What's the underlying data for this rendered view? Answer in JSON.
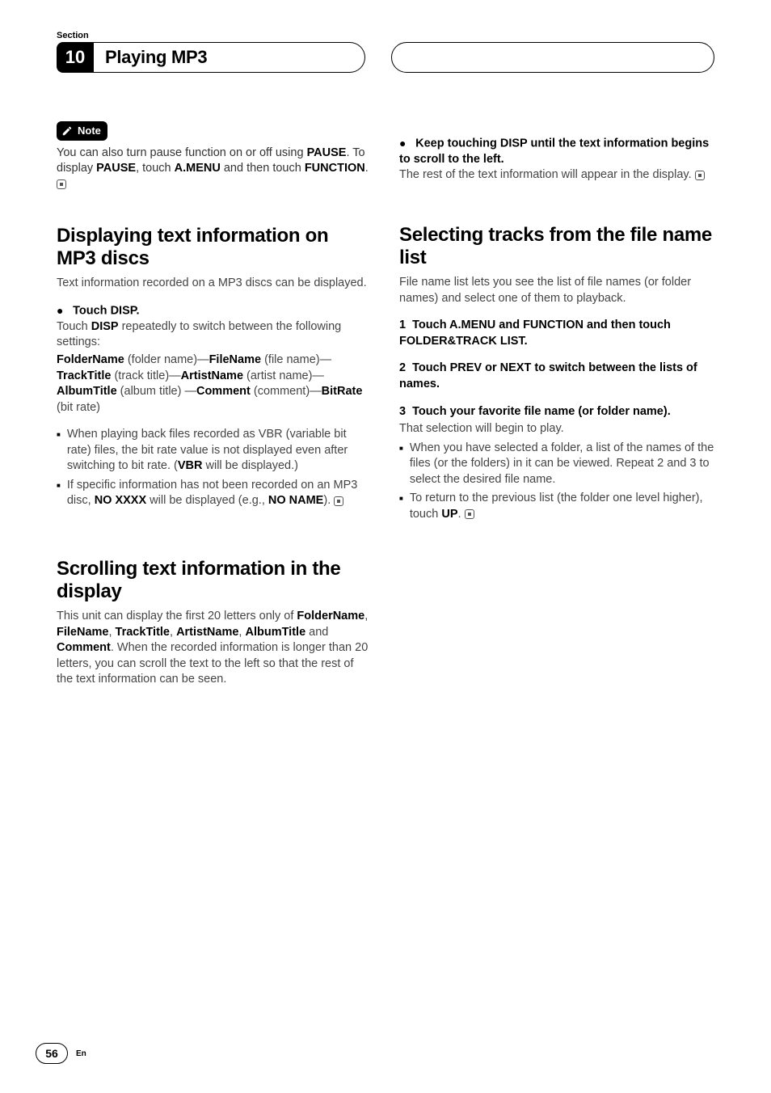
{
  "header": {
    "section_label": "Section",
    "chapter_number": "10",
    "chapter_title": "Playing MP3"
  },
  "left": {
    "note_label": "Note",
    "note_text_a": "You can also turn pause function on or off using ",
    "note_b1": "PAUSE",
    "note_text_b": ". To display ",
    "note_b2": "PAUSE",
    "note_text_c": ", touch ",
    "note_b3": "A.MENU",
    "note_text_d": " and then touch ",
    "note_b4": "FUNCTION",
    "h1": "Displaying text information on MP3 discs",
    "p1": "Text information recorded on a MP3 discs can be displayed.",
    "step1": "Touch DISP.",
    "p2a": "Touch ",
    "p2b": "DISP",
    "p2c": " repeatedly to switch between the following settings:",
    "seq1": "FolderName",
    "seq1d": " (folder name)—",
    "seq2": "FileName",
    "seq2d": " (file name)—",
    "seq3": "TrackTitle",
    "seq3d": " (track title)—",
    "seq4": "ArtistName",
    "seq4d": " (artist name)—",
    "seq5": "AlbumTitle",
    "seq5d": " (album title) —",
    "seq6": "Comment",
    "seq6d": " (comment)—",
    "seq7": "BitRate",
    "seq7d": " (bit rate)",
    "li1a": "When playing back files recorded as VBR (variable bit rate) files, the bit rate value is not displayed even after switching to bit rate. (",
    "li1b": "VBR",
    "li1c": " will be displayed.)",
    "li2a": "If specific information has not been recorded on an MP3 disc, ",
    "li2b": "NO XXXX",
    "li2c": " will be displayed (e.g., ",
    "li2d": "NO NAME",
    "li2e": ").",
    "h2": "Scrolling text information in the display",
    "p3a": "This unit can display the first 20 letters only of ",
    "p3b1": "FolderName",
    "p3c1": ", ",
    "p3b2": "FileName",
    "p3c2": ", ",
    "p3b3": "TrackTitle",
    "p3c3": ", ",
    "p3b4": "ArtistName",
    "p3c4": ", ",
    "p3b5": "AlbumTitle",
    "p3c5": " and ",
    "p3b6": "Comment",
    "p3d": ". When the recorded information is longer than 20 letters, you can scroll the text to the left so that the rest of the text information can be seen."
  },
  "right": {
    "step1": "Keep touching DISP until the text information begins to scroll to the left.",
    "p1": "The rest of the text information will appear in the display.",
    "h1": "Selecting tracks from the file name list",
    "p2": "File name list lets you see the list of file names (or folder names) and select one of them to playback.",
    "s1": "Touch A.MENU and FUNCTION and then touch FOLDER&TRACK LIST.",
    "s2": "Touch PREV or NEXT to switch between the lists of names.",
    "s3": "Touch your favorite file name (or folder name).",
    "p3": "That selection will begin to play.",
    "li1": "When you have selected a folder, a list of the names of the files (or the folders) in it can be viewed. Repeat 2 and 3 to select the desired file name.",
    "li2a": "To return to the previous list (the folder one level higher), touch ",
    "li2b": "UP",
    "li2c": "."
  },
  "footer": {
    "page": "56",
    "lang": "En"
  }
}
